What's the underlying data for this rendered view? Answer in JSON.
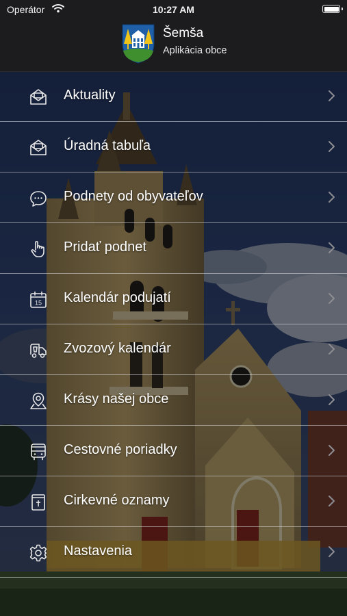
{
  "status_bar": {
    "carrier": "Operátor",
    "time": "10:27 AM",
    "icons": [
      "wifi-icon",
      "battery-icon"
    ]
  },
  "header": {
    "title": "Šemša",
    "subtitle": "Aplikácia obce",
    "logo": "coat-of-arms"
  },
  "menu": {
    "items": [
      {
        "label": "Aktuality",
        "icon": "envelope-icon"
      },
      {
        "label": "Úradná tabuľa",
        "icon": "envelope-icon"
      },
      {
        "label": "Podnety od obyvateľov",
        "icon": "chat-bubble-icon"
      },
      {
        "label": "Pridať podnet",
        "icon": "pointing-hand-icon"
      },
      {
        "label": "Kalendár podujatí",
        "icon": "calendar-icon",
        "calendar_day": "15"
      },
      {
        "label": "Zvozový kalendár",
        "icon": "garbage-truck-icon"
      },
      {
        "label": "Krásy našej obce",
        "icon": "map-pin-icon"
      },
      {
        "label": "Cestovné poriadky",
        "icon": "bus-icon"
      },
      {
        "label": "Cirkevné oznamy",
        "icon": "church-notice-icon"
      },
      {
        "label": "Nastavenia",
        "icon": "gear-icon"
      }
    ]
  },
  "colors": {
    "bar_bg": "#1c1c1e",
    "text": "#ffffff",
    "crest_blue": "#1f5fa8",
    "crest_green": "#3f8f2f",
    "crest_yellow": "#f0c419"
  }
}
